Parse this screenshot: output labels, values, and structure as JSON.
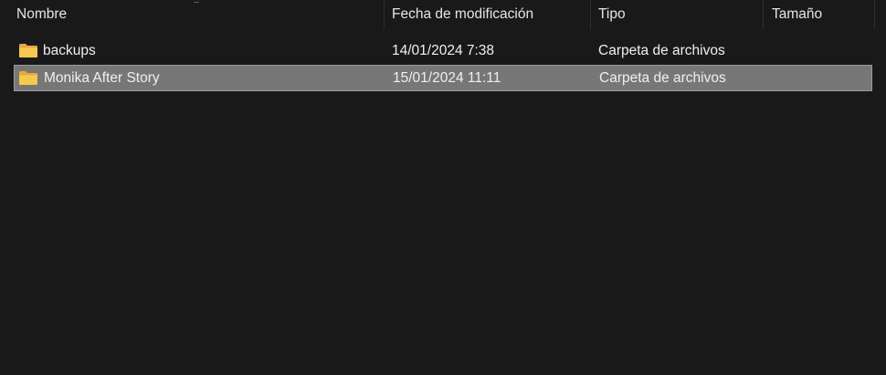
{
  "columns": {
    "name": "Nombre",
    "date": "Fecha de modificación",
    "type": "Tipo",
    "size": "Tamaño"
  },
  "rows": [
    {
      "name": "backups",
      "date": "14/01/2024 7:38",
      "type": "Carpeta de archivos",
      "size": "",
      "icon": "folder-icon",
      "selected": false
    },
    {
      "name": "Monika After Story",
      "date": "15/01/2024 11:11",
      "type": "Carpeta de archivos",
      "size": "",
      "icon": "folder-icon",
      "selected": true
    }
  ],
  "colors": {
    "background": "#191919",
    "selection": "#777777",
    "folder": "#F4C545"
  }
}
